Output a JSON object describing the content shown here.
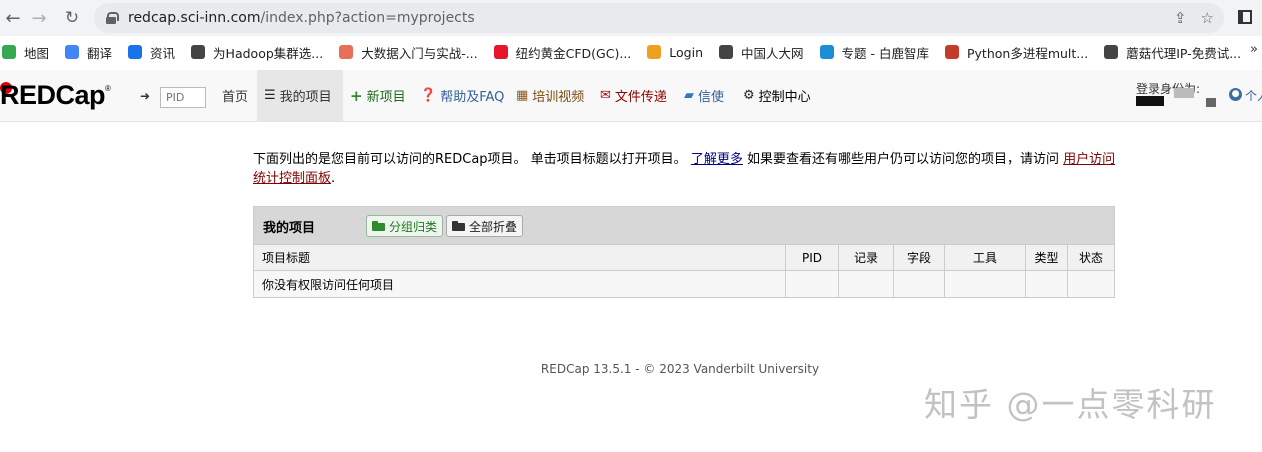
{
  "browser": {
    "url_host": "redcap.sci-inn.com",
    "url_path": "/index.php?action=myprojects",
    "bookmarks": [
      {
        "label": "地图",
        "icon": "maps-icon",
        "color": "#34a853"
      },
      {
        "label": "翻译",
        "icon": "translate-icon",
        "color": "#4285f4"
      },
      {
        "label": "资讯",
        "icon": "news-icon",
        "color": "#1a73e8"
      },
      {
        "label": "为Hadoop集群选...",
        "icon": "site-icon",
        "color": "#444444"
      },
      {
        "label": "大数据入门与实战-...",
        "icon": "jianshu-icon",
        "color": "#ea6f5a"
      },
      {
        "label": "纽约黄金CFD(GC)...",
        "icon": "weibo-icon",
        "color": "#e6162d"
      },
      {
        "label": "Login",
        "icon": "login-icon",
        "color": "#f0a020"
      },
      {
        "label": "中国人大网",
        "icon": "globe-icon",
        "color": "#444444"
      },
      {
        "label": "专题 - 白鹿智库",
        "icon": "bailu-icon",
        "color": "#1b8fd6"
      },
      {
        "label": "Python多进程mult...",
        "icon": "csdn-icon",
        "color": "#c33c2a"
      },
      {
        "label": "蘑菇代理IP-免费试...",
        "icon": "globe-icon",
        "color": "#444444"
      }
    ],
    "more": "»"
  },
  "navbar": {
    "logo": "REDCap",
    "logo_reg": "®",
    "pid_placeholder": "PID",
    "items": {
      "home": "首页",
      "my_projects": "我的项目",
      "new_project": "新项目",
      "help": "帮助及FAQ",
      "training": "培训视频",
      "file_share": "文件传递",
      "messenger": "信使",
      "control_center": "控制中心"
    },
    "user_label": "登录身份为:",
    "user_menu": "个人"
  },
  "main": {
    "intro_part1": "下面列出的是您目前可以访问的REDCap项目。 单击项目标题以打开项目。",
    "learn_more": "了解更多",
    "intro_part2": "如果要查看还有哪些用户仍可以访问您的项目，请访问",
    "user_access_link": "用户访问统计控制面板",
    "intro_end": ".",
    "table": {
      "title": "我的项目",
      "group_button": "分组归类",
      "collapse_button": "全部折叠",
      "columns": [
        "项目标题",
        "PID",
        "记录",
        "字段",
        "工具",
        "类型",
        "状态"
      ],
      "empty_row": "你没有权限访问任何项目"
    }
  },
  "footer": "REDCap 13.5.1 - © 2023 Vanderbilt University",
  "watermark": "知乎 @一点零科研"
}
